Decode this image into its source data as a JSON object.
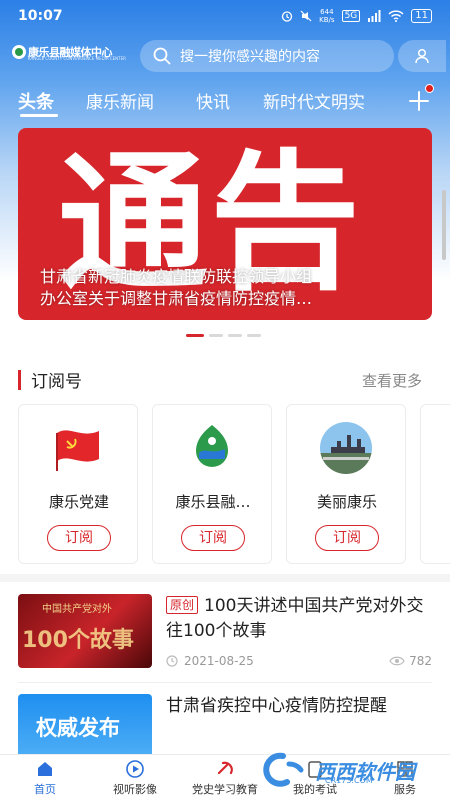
{
  "status_bar": {
    "time": "10:07",
    "speed": "644\nKB/s",
    "network": "5G",
    "battery": "11"
  },
  "header": {
    "logo_text": "康乐县融媒体中心",
    "logo_subtext": "KANGLE COUNTY CONVERGENCE MEDIA CENTER",
    "search_placeholder": "搜一搜你感兴趣的内容"
  },
  "tabs": [
    {
      "label": "头条",
      "active": true
    },
    {
      "label": "康乐新闻",
      "active": false
    },
    {
      "label": "快讯",
      "active": false
    },
    {
      "label": "新时代文明实",
      "active": false
    }
  ],
  "banner": {
    "image_text": "通告",
    "caption_line1": "甘肃省新冠肺炎疫情联防联控领导小组",
    "caption_line2": "办公室关于调整甘肃省疫情防控疫情…"
  },
  "carousel": {
    "count": 4,
    "active_index": 0
  },
  "subscriptions": {
    "title": "订阅号",
    "more_label": "查看更多",
    "items": [
      {
        "name": "康乐党建",
        "button": "订阅",
        "icon": "party-flag-icon"
      },
      {
        "name": "康乐县融…",
        "button": "订阅",
        "icon": "media-center-logo-icon"
      },
      {
        "name": "美丽康乐",
        "button": "订阅",
        "icon": "city-landmark-icon"
      }
    ]
  },
  "news": [
    {
      "tag": "原创",
      "title": "100天讲述中国共产党对外交往100个故事",
      "thumb_text": "中国共产党对外",
      "thumb_big": "100个故事",
      "date": "2021-08-25",
      "views": "782"
    },
    {
      "tag": "",
      "title": "甘肃省疾控中心疫情防控提醒",
      "thumb_text": "权威发布",
      "date": "",
      "views": ""
    }
  ],
  "bottom_nav": [
    {
      "label": "首页",
      "icon": "home-icon",
      "active": true
    },
    {
      "label": "视听影像",
      "icon": "play-icon",
      "active": false
    },
    {
      "label": "党史学习教育",
      "icon": "party-emblem-icon",
      "active": false
    },
    {
      "label": "我的考试",
      "icon": "exam-icon",
      "active": false
    },
    {
      "label": "服务",
      "icon": "service-icon",
      "active": false
    }
  ],
  "watermark": {
    "text": "西西软件园",
    "sub": "CR173.COM"
  },
  "colors": {
    "brand_blue": "#2b7fe6",
    "accent_red": "#d7262b"
  }
}
